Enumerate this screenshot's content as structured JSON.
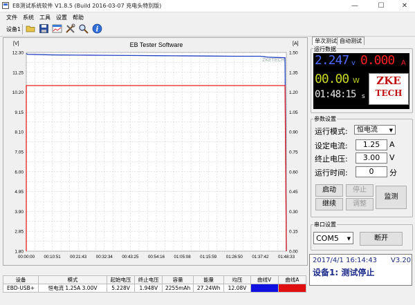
{
  "window": {
    "title": "EB测试系统软件 V1.8.5 (Build 2016-03-07 充电头特别版)",
    "minimize": "—",
    "maximize": "☐",
    "close": "✕"
  },
  "menu": [
    "文件",
    "系统",
    "工具",
    "设置",
    "帮助"
  ],
  "toolbar": {
    "device_label": "设备1",
    "icons": [
      "open-folder-icon",
      "save-icon",
      "chart-icon",
      "tools-icon",
      "search-icon",
      "info-icon"
    ]
  },
  "chart": {
    "title": "EB Tester Software",
    "left_unit": "[V]",
    "right_unit": "[A]",
    "watermark": "ZKETECH",
    "y_left_ticks": [
      "12.30",
      "11.25",
      "10.20",
      "9.15",
      "8.10",
      "7.05",
      "6.00",
      "4.95",
      "3.90",
      "2.85",
      "1.80"
    ],
    "y_right_ticks": [
      "1.50",
      "1.35",
      "1.20",
      "1.05",
      "0.90",
      "0.75",
      "0.60",
      "0.45",
      "0.30",
      "0.15",
      "0.00"
    ],
    "x_ticks": [
      "00:00:00",
      "00:10:51",
      "00:21:43",
      "00:32:34",
      "00:43:25",
      "00:54:16",
      "01:05:08",
      "01:15:59",
      "01:26:50",
      "01:37:42",
      "01:48:33"
    ],
    "line_colors": {
      "voltage": "#1f3fbf",
      "current": "#e02020"
    }
  },
  "chart_data": {
    "type": "line",
    "title": "EB Tester Software",
    "xlabel": "",
    "ylabel": "[V]",
    "y2label": "[A]",
    "x": [
      "00:00:00",
      "00:00:30",
      "00:10:51",
      "00:21:43",
      "00:32:34",
      "00:43:25",
      "00:54:16",
      "01:05:08",
      "01:15:59",
      "01:26:50",
      "01:37:42",
      "01:41:00",
      "01:48:00",
      "01:48:33"
    ],
    "series": [
      {
        "name": "V",
        "axis": "left",
        "values": [
          12.25,
          12.2,
          12.17,
          12.16,
          12.15,
          12.14,
          12.13,
          12.12,
          12.11,
          12.1,
          12.1,
          12.05,
          12.02,
          1.8
        ]
      },
      {
        "name": "A",
        "axis": "right",
        "values": [
          1.25,
          1.25,
          1.25,
          1.25,
          1.25,
          1.25,
          1.25,
          1.25,
          1.25,
          1.25,
          1.25,
          1.25,
          1.25,
          0.0
        ]
      }
    ],
    "ylim": [
      1.8,
      12.3
    ],
    "y2lim": [
      0.0,
      1.5
    ],
    "grid": true
  },
  "right_panel": {
    "tabs": [
      "单次测试",
      "自动测试"
    ],
    "readings": {
      "group_title": "运行数据",
      "voltage": "2.247",
      "voltage_unit": "v",
      "current": "0.000",
      "current_unit": "A",
      "power": "00.00",
      "power_unit": "W",
      "time": "01:48:15",
      "time_unit": "s",
      "logo_top": "ZKE",
      "logo_bottom": "TECH"
    },
    "params": {
      "group_title": "参数设置",
      "mode_label": "运行模式:",
      "mode_value": "恒电流",
      "current_label": "设定电流:",
      "current_value": "1.25",
      "current_unit": "A",
      "voltage_label": "终止电压:",
      "voltage_value": "3.00",
      "voltage_unit": "V",
      "time_label": "运行时间:",
      "time_value": "0",
      "time_unit": "分",
      "start": "启动",
      "stop": "停止",
      "continue": "继续",
      "adjust": "调整",
      "monitor": "监测"
    },
    "serial": {
      "group_title": "串口设置",
      "port": "COM5",
      "disconnect": "断开"
    },
    "status": {
      "datetime": "2017/4/1 16:14:43",
      "version": "V3.20",
      "message": "设备1: 测试停止"
    }
  },
  "table": {
    "headers": [
      "设备",
      "模式",
      "起始电压",
      "终止电压",
      "容量",
      "能量",
      "均压",
      "曲线V",
      "曲线A"
    ],
    "rows": [
      {
        "device": "EBD-USB+",
        "mode": "恒电流 1.25A 3.00V",
        "start_v": "5.228V",
        "end_v": "1.948V",
        "capacity": "2255mAh",
        "energy": "27.24Wh",
        "avg_v": "12.08V",
        "color_v": "#1010e0",
        "color_a": "#e01010"
      }
    ]
  }
}
